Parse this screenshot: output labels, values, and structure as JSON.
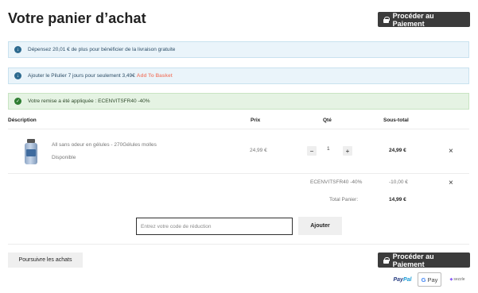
{
  "header": {
    "title": "Votre panier d’achat",
    "checkout_label": "Procéder au Paiement"
  },
  "notices": {
    "shipping": "Dépensez 20,01 € de plus pour bénéficier de la livraison gratuite",
    "upsell_text": "Ajouter le Pilulier 7 jours pour seulement 3,49€",
    "upsell_link": "Add To Basket",
    "discount_applied": "Votre remise a été appliquée : ECENVITSFR40 -40%"
  },
  "table": {
    "headers": {
      "description": "Déscription",
      "price": "Prix",
      "qty": "Qté",
      "subtotal": "Sous-total"
    },
    "item": {
      "name": "All sans odeur en gélules - 270Gélules molles",
      "availability": "Disponible",
      "price": "24,99 €",
      "quantity": "1",
      "subtotal": "24,99 €"
    },
    "discount": {
      "label": "ECENVITSFR40 -40%",
      "amount": "-10,00 €"
    },
    "total": {
      "label": "Total Panier:",
      "amount": "14,99 €"
    }
  },
  "coupon": {
    "placeholder": "Entrez votre code de réduction",
    "apply_label": "Ajouter"
  },
  "footer": {
    "continue_label": "Poursuivre les achats",
    "checkout_label": "Procéder au Paiement",
    "payments": {
      "paypal_a": "Pay",
      "paypal_b": "Pal",
      "gpay_g": "G",
      "gpay_text": "Pay",
      "sezzle": "sezzle"
    }
  },
  "colors": {
    "dark_button": "#3b3b3b",
    "info_bg": "#eaf4fa",
    "success_bg": "#e5f3e3",
    "add_basket": "#f08a7a"
  }
}
